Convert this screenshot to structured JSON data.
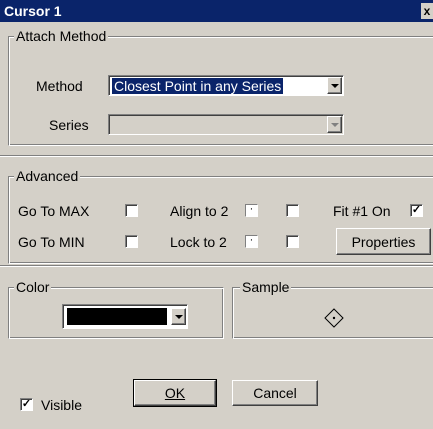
{
  "window": {
    "title": "Cursor 1",
    "close_glyph": "x"
  },
  "attach": {
    "legend": "Attach Method",
    "method_label": "Method",
    "method_value": "Closest Point in any Series",
    "series_label": "Series",
    "series_value": ""
  },
  "advanced": {
    "legend": "Advanced",
    "go_to_max": "Go To MAX",
    "go_to_min": "Go To MIN",
    "align_to_2": "Align to 2",
    "lock_to_2": "Lock to 2",
    "fit_on": "Fit #1 On",
    "fit_checked": true,
    "properties_label": "Properties"
  },
  "color": {
    "legend": "Color",
    "swatch": "#000000"
  },
  "sample": {
    "legend": "Sample",
    "symbol": "diamond-with-dot"
  },
  "footer": {
    "visible_label": "Visible",
    "visible_checked": true,
    "ok_label": "OK",
    "cancel_label": "Cancel"
  }
}
